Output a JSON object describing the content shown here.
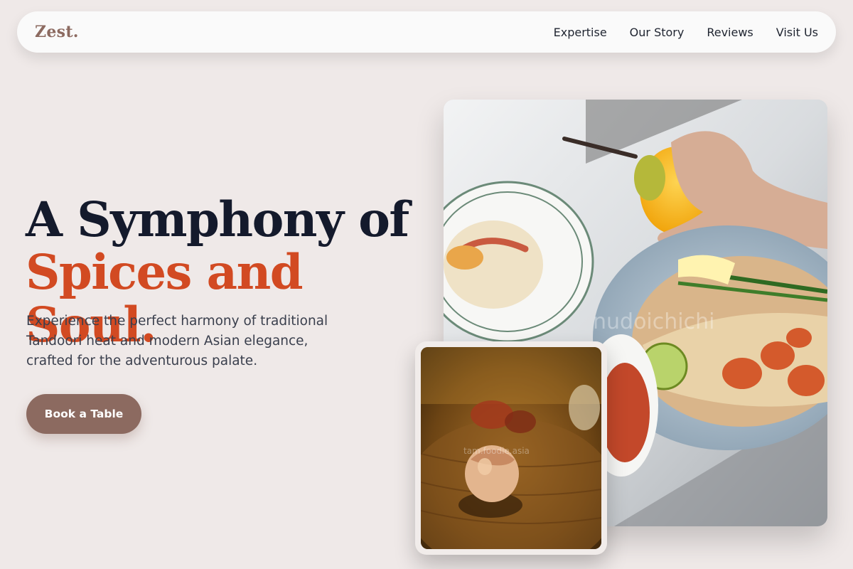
{
  "brand": {
    "logo": "Zest."
  },
  "nav": {
    "links": [
      {
        "label": "Expertise"
      },
      {
        "label": "Our Story"
      },
      {
        "label": "Reviews"
      },
      {
        "label": "Visit Us"
      }
    ]
  },
  "hero": {
    "title_line1": "A Symphony of",
    "title_line2": "Spices and Soul.",
    "subtitle": "Experience the perfect harmony of traditional Tandoori heat and modern Asian elegance, crafted for the adventurous palate.",
    "cta_label": "Book a Table"
  },
  "images": {
    "main_watermark": "nudoichichi",
    "inset_watermark": "tam.foodie.asia"
  },
  "colors": {
    "background": "#efe9e8",
    "brand": "#8c6a60",
    "accent": "#d24a22",
    "heading": "#141a2c"
  }
}
